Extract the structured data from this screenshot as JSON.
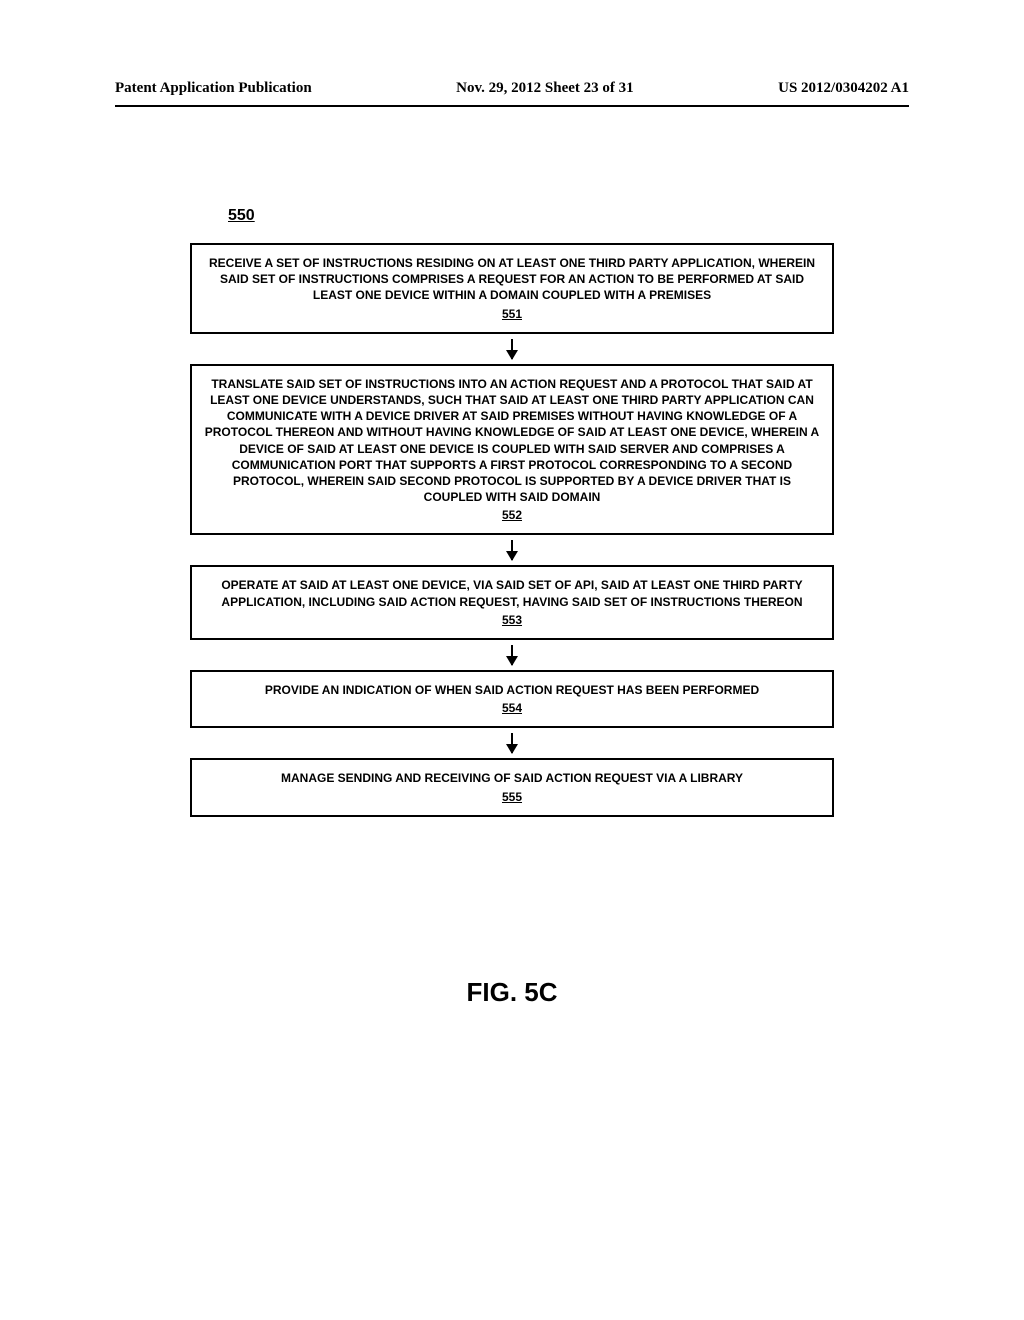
{
  "header": {
    "left": "Patent Application Publication",
    "center": "Nov. 29, 2012  Sheet 23 of 31",
    "right": "US 2012/0304202 A1"
  },
  "diagram": {
    "number": "550",
    "boxes": [
      {
        "text": "RECEIVE A SET OF INSTRUCTIONS RESIDING ON AT LEAST ONE THIRD PARTY APPLICATION, WHEREIN SAID SET OF INSTRUCTIONS COMPRISES A REQUEST FOR AN ACTION TO BE PERFORMED AT SAID LEAST ONE DEVICE WITHIN A DOMAIN COUPLED WITH A PREMISES",
        "ref": "551"
      },
      {
        "text": "TRANSLATE SAID SET OF INSTRUCTIONS INTO AN ACTION REQUEST AND A PROTOCOL THAT SAID AT LEAST ONE DEVICE UNDERSTANDS, SUCH THAT SAID AT LEAST ONE THIRD PARTY APPLICATION CAN COMMUNICATE WITH A DEVICE DRIVER AT SAID PREMISES WITHOUT HAVING KNOWLEDGE OF A PROTOCOL THEREON AND WITHOUT HAVING KNOWLEDGE OF SAID AT LEAST ONE DEVICE, WHEREIN A DEVICE OF SAID AT LEAST ONE DEVICE IS COUPLED WITH SAID SERVER AND COMPRISES A COMMUNICATION PORT THAT SUPPORTS A FIRST PROTOCOL CORRESPONDING TO A SECOND PROTOCOL, WHEREIN SAID SECOND PROTOCOL IS SUPPORTED BY A DEVICE DRIVER THAT IS COUPLED WITH SAID DOMAIN",
        "ref": "552"
      },
      {
        "text": "OPERATE AT SAID AT LEAST ONE DEVICE, VIA SAID SET OF API, SAID AT LEAST ONE THIRD PARTY APPLICATION, INCLUDING SAID ACTION REQUEST, HAVING SAID SET OF INSTRUCTIONS THEREON",
        "ref": "553"
      },
      {
        "text": "PROVIDE AN INDICATION OF WHEN SAID ACTION REQUEST HAS BEEN PERFORMED",
        "ref": "554"
      },
      {
        "text": "MANAGE SENDING AND RECEIVING OF SAID ACTION REQUEST VIA A LIBRARY",
        "ref": "555"
      }
    ]
  },
  "figure_label": "FIG. 5C"
}
